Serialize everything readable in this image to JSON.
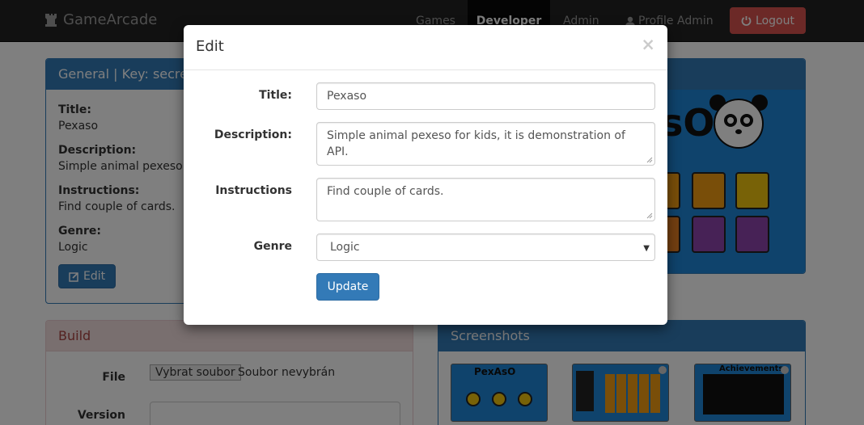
{
  "navbar": {
    "brand": "GameArcade",
    "items": {
      "games": "Games",
      "developer": "Developer",
      "admin": "Admin",
      "profile": "Profile Admin",
      "logout": "Logout"
    }
  },
  "general_panel": {
    "heading": "General | Key: secre",
    "fields": [
      {
        "label": "Title:",
        "value": "Pexaso"
      },
      {
        "label": "Description:",
        "value": "Simple animal pexeso"
      },
      {
        "label": "Instructions:",
        "value": "Find couple of cards."
      },
      {
        "label": "Genre:",
        "value": "Logic"
      }
    ],
    "edit_button": "Edit"
  },
  "cover": {
    "logo_text": "sO"
  },
  "build_panel": {
    "heading": "Build",
    "file_label": "File",
    "file_button": "Vybrat soubor",
    "file_status": "Soubor nevybrán",
    "version_label": "Version"
  },
  "screenshots_panel": {
    "heading": "Screenshots",
    "thumbs": [
      {
        "caption": "PexAsO"
      },
      {
        "caption": ""
      },
      {
        "caption": "Achievements"
      }
    ]
  },
  "modal": {
    "title": "Edit",
    "close": "×",
    "labels": {
      "title": "Title:",
      "description": "Description:",
      "instructions": "Instructions",
      "genre": "Genre"
    },
    "values": {
      "title": "Pexaso",
      "description": "Simple animal pexeso for kids, it is demonstration of API.",
      "instructions": "Find couple of cards.",
      "genre": "Logic"
    },
    "update_button": "Update"
  },
  "colors": {
    "primary": "#337ab7",
    "danger": "#d9534f",
    "navbar": "#222222"
  }
}
